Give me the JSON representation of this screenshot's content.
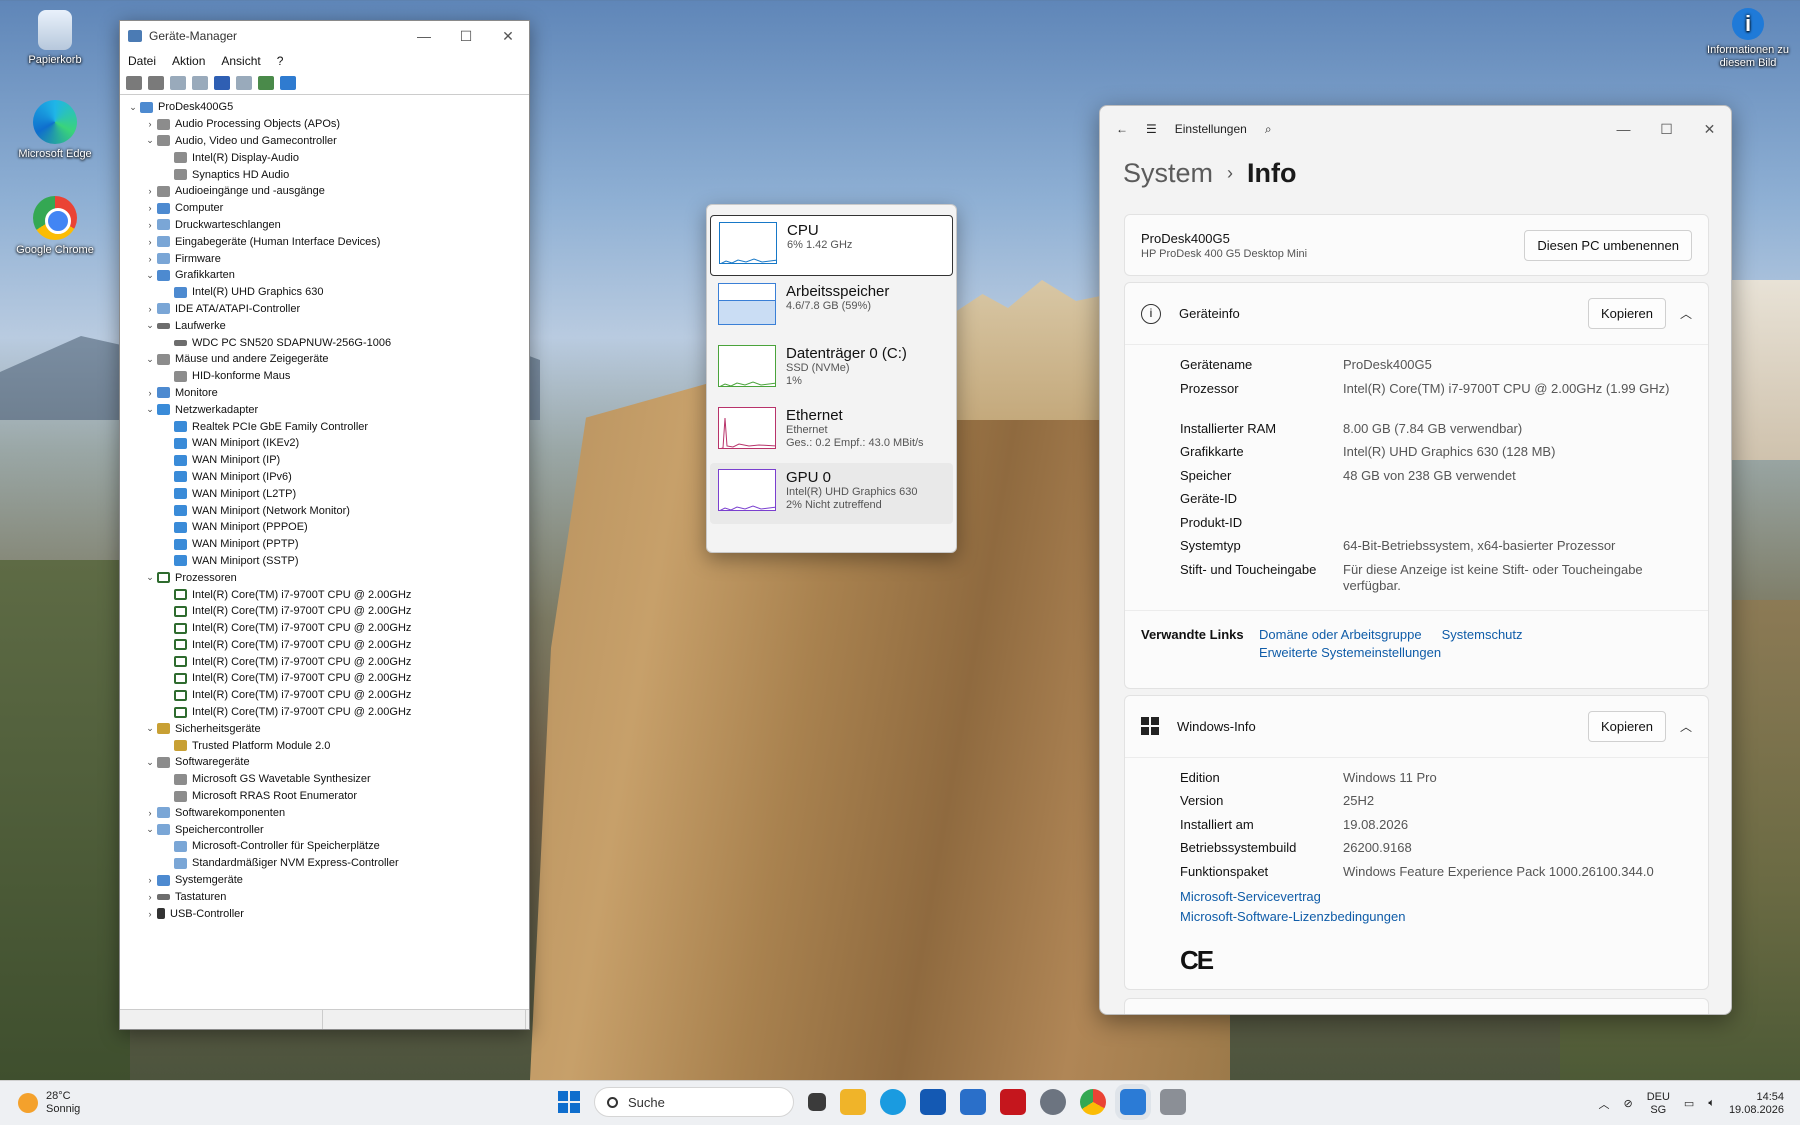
{
  "desktop": {
    "icons": [
      {
        "label": "Papierkorb"
      },
      {
        "label": "Microsoft Edge"
      },
      {
        "label": "Google Chrome"
      },
      {
        "label": "Informationen zu diesem Bild"
      }
    ]
  },
  "device_manager": {
    "title": "Geräte-Manager",
    "menu": [
      "Datei",
      "Aktion",
      "Ansicht",
      "?"
    ],
    "tree": [
      {
        "level": 0,
        "exp": "v",
        "icon": "pc",
        "label": "ProDesk400G5"
      },
      {
        "level": 1,
        "exp": ">",
        "icon": "aud",
        "label": "Audio Processing Objects (APOs)"
      },
      {
        "level": 1,
        "exp": "v",
        "icon": "aud",
        "label": "Audio, Video und Gamecontroller"
      },
      {
        "level": 2,
        "exp": "",
        "icon": "aud",
        "label": "Intel(R) Display-Audio"
      },
      {
        "level": 2,
        "exp": "",
        "icon": "aud",
        "label": "Synaptics HD Audio"
      },
      {
        "level": 1,
        "exp": ">",
        "icon": "aud",
        "label": "Audioeingänge und -ausgänge"
      },
      {
        "level": 1,
        "exp": ">",
        "icon": "pc",
        "label": "Computer"
      },
      {
        "level": 1,
        "exp": ">",
        "icon": "gen",
        "label": "Druckwarteschlangen"
      },
      {
        "level": 1,
        "exp": ">",
        "icon": "gen",
        "label": "Eingabegeräte (Human Interface Devices)"
      },
      {
        "level": 1,
        "exp": ">",
        "icon": "gen",
        "label": "Firmware"
      },
      {
        "level": 1,
        "exp": "v",
        "icon": "pc",
        "label": "Grafikkarten"
      },
      {
        "level": 2,
        "exp": "",
        "icon": "pc",
        "label": "Intel(R) UHD Graphics 630"
      },
      {
        "level": 1,
        "exp": ">",
        "icon": "gen",
        "label": "IDE ATA/ATAPI-Controller"
      },
      {
        "level": 1,
        "exp": "v",
        "icon": "disk",
        "label": "Laufwerke"
      },
      {
        "level": 2,
        "exp": "",
        "icon": "disk",
        "label": "WDC PC SN520 SDAPNUW-256G-1006"
      },
      {
        "level": 1,
        "exp": "v",
        "icon": "aud",
        "label": "Mäuse und andere Zeigegeräte"
      },
      {
        "level": 2,
        "exp": "",
        "icon": "aud",
        "label": "HID-konforme Maus"
      },
      {
        "level": 1,
        "exp": ">",
        "icon": "pc",
        "label": "Monitore"
      },
      {
        "level": 1,
        "exp": "v",
        "icon": "net",
        "label": "Netzwerkadapter"
      },
      {
        "level": 2,
        "exp": "",
        "icon": "net",
        "label": "Realtek PCIe GbE Family Controller"
      },
      {
        "level": 2,
        "exp": "",
        "icon": "net",
        "label": "WAN Miniport (IKEv2)"
      },
      {
        "level": 2,
        "exp": "",
        "icon": "net",
        "label": "WAN Miniport (IP)"
      },
      {
        "level": 2,
        "exp": "",
        "icon": "net",
        "label": "WAN Miniport (IPv6)"
      },
      {
        "level": 2,
        "exp": "",
        "icon": "net",
        "label": "WAN Miniport (L2TP)"
      },
      {
        "level": 2,
        "exp": "",
        "icon": "net",
        "label": "WAN Miniport (Network Monitor)"
      },
      {
        "level": 2,
        "exp": "",
        "icon": "net",
        "label": "WAN Miniport (PPPOE)"
      },
      {
        "level": 2,
        "exp": "",
        "icon": "net",
        "label": "WAN Miniport (PPTP)"
      },
      {
        "level": 2,
        "exp": "",
        "icon": "net",
        "label": "WAN Miniport (SSTP)"
      },
      {
        "level": 1,
        "exp": "v",
        "icon": "cpu",
        "label": "Prozessoren"
      },
      {
        "level": 2,
        "exp": "",
        "icon": "cpu",
        "label": "Intel(R) Core(TM) i7-9700T CPU @ 2.00GHz"
      },
      {
        "level": 2,
        "exp": "",
        "icon": "cpu",
        "label": "Intel(R) Core(TM) i7-9700T CPU @ 2.00GHz"
      },
      {
        "level": 2,
        "exp": "",
        "icon": "cpu",
        "label": "Intel(R) Core(TM) i7-9700T CPU @ 2.00GHz"
      },
      {
        "level": 2,
        "exp": "",
        "icon": "cpu",
        "label": "Intel(R) Core(TM) i7-9700T CPU @ 2.00GHz"
      },
      {
        "level": 2,
        "exp": "",
        "icon": "cpu",
        "label": "Intel(R) Core(TM) i7-9700T CPU @ 2.00GHz"
      },
      {
        "level": 2,
        "exp": "",
        "icon": "cpu",
        "label": "Intel(R) Core(TM) i7-9700T CPU @ 2.00GHz"
      },
      {
        "level": 2,
        "exp": "",
        "icon": "cpu",
        "label": "Intel(R) Core(TM) i7-9700T CPU @ 2.00GHz"
      },
      {
        "level": 2,
        "exp": "",
        "icon": "cpu",
        "label": "Intel(R) Core(TM) i7-9700T CPU @ 2.00GHz"
      },
      {
        "level": 1,
        "exp": "v",
        "icon": "sec",
        "label": "Sicherheitsgeräte"
      },
      {
        "level": 2,
        "exp": "",
        "icon": "sec",
        "label": "Trusted Platform Module 2.0"
      },
      {
        "level": 1,
        "exp": "v",
        "icon": "aud",
        "label": "Softwaregeräte"
      },
      {
        "level": 2,
        "exp": "",
        "icon": "aud",
        "label": "Microsoft GS Wavetable Synthesizer"
      },
      {
        "level": 2,
        "exp": "",
        "icon": "aud",
        "label": "Microsoft RRAS Root Enumerator"
      },
      {
        "level": 1,
        "exp": ">",
        "icon": "gen",
        "label": "Softwarekomponenten"
      },
      {
        "level": 1,
        "exp": "v",
        "icon": "gen",
        "label": "Speichercontroller"
      },
      {
        "level": 2,
        "exp": "",
        "icon": "gen",
        "label": "Microsoft-Controller für Speicherplätze"
      },
      {
        "level": 2,
        "exp": "",
        "icon": "gen",
        "label": "Standardmäßiger NVM Express-Controller"
      },
      {
        "level": 1,
        "exp": ">",
        "icon": "pc",
        "label": "Systemgeräte"
      },
      {
        "level": 1,
        "exp": ">",
        "icon": "disk",
        "label": "Tastaturen"
      },
      {
        "level": 1,
        "exp": ">",
        "icon": "usb",
        "label": "USB-Controller"
      }
    ]
  },
  "task_manager": {
    "items": [
      {
        "name": "CPU",
        "sub1": "6% 1.42 GHz",
        "sub2": "",
        "sub3": "",
        "color": "#1778c7",
        "state": "sel"
      },
      {
        "name": "Arbeitsspeicher",
        "sub1": "4.6/7.8 GB (59%)",
        "sub2": "",
        "sub3": "",
        "color": "#3a7fd6",
        "state": ""
      },
      {
        "name": "Datenträger 0 (C:)",
        "sub1": "SSD (NVMe)",
        "sub2": "1%",
        "sub3": "",
        "color": "#4aa33b",
        "state": ""
      },
      {
        "name": "Ethernet",
        "sub1": "Ethernet",
        "sub2": "Ges.: 0.2 Empf.: 43.0 MBit/s",
        "sub3": "",
        "color": "#b8336a",
        "state": ""
      },
      {
        "name": "GPU 0",
        "sub1": "Intel(R) UHD Graphics 630",
        "sub2": "2% Nicht zutreffend",
        "sub3": "",
        "color": "#7a3fcf",
        "state": "hov"
      }
    ]
  },
  "settings": {
    "app_title": "Einstellungen",
    "breadcrumb_parent": "System",
    "breadcrumb_current": "Info",
    "pc_name": "ProDesk400G5",
    "pc_model": "HP ProDesk 400 G5 Desktop Mini",
    "rename_button": "Diesen PC umbenennen",
    "device_section": {
      "title": "Geräteinfo",
      "copy_button": "Kopieren",
      "rows": [
        {
          "k": "Gerätename",
          "v": "ProDesk400G5"
        },
        {
          "k": "Prozessor",
          "v": "Intel(R) Core(TM) i7-9700T CPU @ 2.00GHz (1.99 GHz)"
        },
        {
          "k": "Installierter RAM",
          "v": "8.00 GB (7.84 GB verwendbar)"
        },
        {
          "k": "Grafikkarte",
          "v": "Intel(R) UHD Graphics 630 (128 MB)"
        },
        {
          "k": "Speicher",
          "v": "48 GB von 238 GB verwendet"
        },
        {
          "k": "Geräte-ID",
          "v": ""
        },
        {
          "k": "Produkt-ID",
          "v": ""
        },
        {
          "k": "Systemtyp",
          "v": "64-Bit-Betriebssystem, x64-basierter Prozessor"
        },
        {
          "k": "Stift- und Toucheingabe",
          "v": "Für diese Anzeige ist keine Stift- oder Toucheingabe verfügbar."
        }
      ]
    },
    "related": {
      "label": "Verwandte Links",
      "link1": "Domäne oder Arbeitsgruppe",
      "link2": "Systemschutz",
      "link3": "Erweiterte Systemeinstellungen"
    },
    "windows_section": {
      "title": "Windows-Info",
      "copy_button": "Kopieren",
      "rows": [
        {
          "k": "Edition",
          "v": "Windows 11 Pro"
        },
        {
          "k": "Version",
          "v": "25H2"
        },
        {
          "k": "Installiert am",
          "v": "19.08.2026"
        },
        {
          "k": "Betriebssystembuild",
          "v": "26200.9168"
        },
        {
          "k": "Funktionspaket",
          "v": "Windows Feature Experience Pack 1000.26100.344.0"
        }
      ],
      "link_service": "Microsoft-Servicevertrag",
      "link_license": "Microsoft-Software-Lizenzbedingungen",
      "ce_mark": "CE"
    }
  },
  "taskbar": {
    "temp": "28°C",
    "weather": "Sonnig",
    "search_placeholder": "Suche",
    "lang1": "DEU",
    "lang2": "SG",
    "time": "14:54",
    "date": "19.08.2026"
  }
}
